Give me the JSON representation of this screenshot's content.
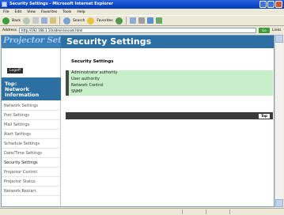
{
  "window": {
    "title": "Security Settings - Microsoft Internet Explorer"
  },
  "menu": [
    "File",
    "Edit",
    "View",
    "Favorites",
    "Tools",
    "Help"
  ],
  "toolbar": {
    "back_label": "Back",
    "search_label": "Search",
    "favorites_label": "Favorites"
  },
  "address": {
    "label": "Address",
    "url": "http://192.168.1.10/admin/secset.html",
    "go_label": "Go",
    "links_label": "Links"
  },
  "header": {
    "logo_text": "Projector Setup",
    "page_title": "Security Settings"
  },
  "sidebar": {
    "logoff_label": "Logoff",
    "top_label_line1": "Top:",
    "top_label_line2": "Network",
    "top_label_line3": "Information",
    "items": [
      {
        "label": "Network Settings"
      },
      {
        "label": "Port Settings"
      },
      {
        "label": "Mail Settings"
      },
      {
        "label": "Alert Settings"
      },
      {
        "label": "Schedule Settings"
      },
      {
        "label": "Date/Time Settings"
      },
      {
        "label": "Security Settings"
      },
      {
        "label": "Projector Control"
      },
      {
        "label": "Projector Status"
      },
      {
        "label": "Network Restart"
      }
    ]
  },
  "content": {
    "section_title": "Security Settings",
    "rows": [
      {
        "label": "Administrator authority"
      },
      {
        "label": "User authority"
      },
      {
        "label": "Network Control"
      },
      {
        "label": "SNMP"
      }
    ],
    "top_button_label": "Top"
  },
  "colors": {
    "header_blue": "#2c6fa3",
    "row_green": "#c8f0c8",
    "dark_bar": "#3a3a3a"
  }
}
